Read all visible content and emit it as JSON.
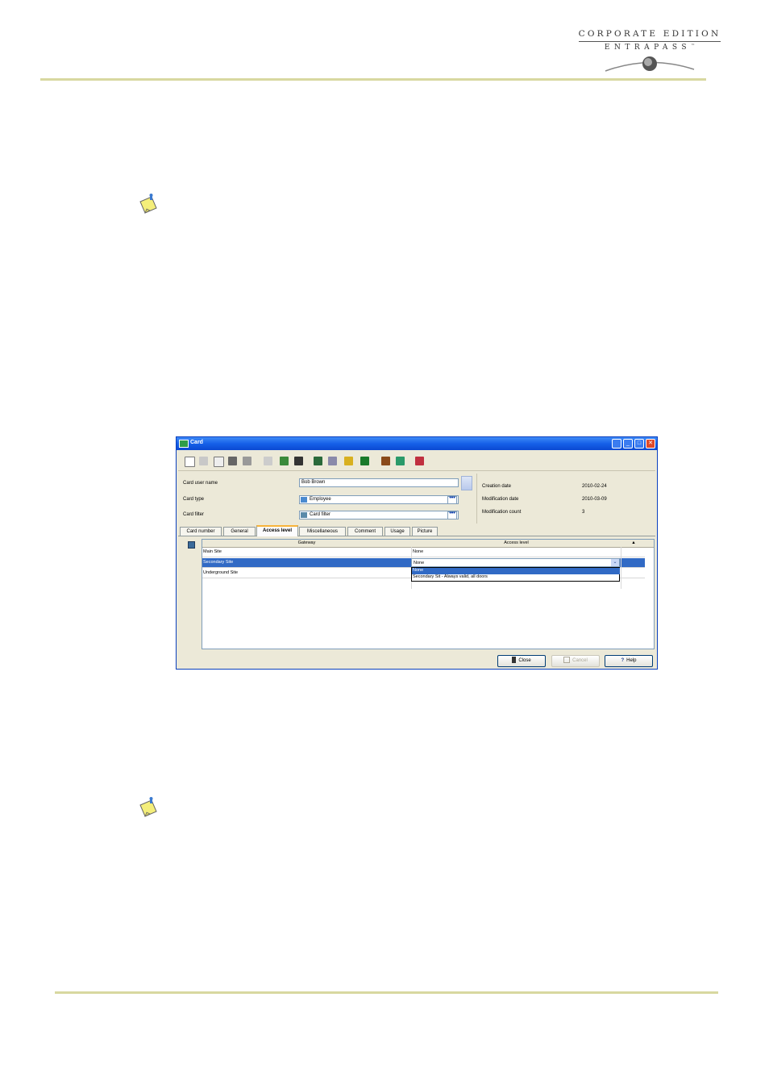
{
  "brand": {
    "line1": "CORPORATE EDITION",
    "line2": "ENTRAPASS",
    "tm": "™"
  },
  "window": {
    "title": "Card",
    "icon": "card-app-icon",
    "controls": [
      "help-icon",
      "minimize-icon",
      "maximize-icon",
      "close-icon"
    ]
  },
  "toolbar": {
    "tools": [
      "new-icon",
      "save-icon",
      "copy-icon",
      "delete-icon",
      "print-icon",
      "list-icon",
      "edit-icon",
      "binoculars-icon",
      "find-icon",
      "grid-icon",
      "key-icon",
      "calendar-icon",
      "photo-icon",
      "link-icon",
      "exit-icon"
    ]
  },
  "form": {
    "card_user_name_label": "Card user name",
    "card_user_name_value": "Bob Brown",
    "card_type_label": "Card type",
    "card_type_value": "Employee",
    "card_filter_label": "Card filter",
    "card_filter_value": "Card filter",
    "ellipsis": "•••"
  },
  "info": {
    "creation_date_label": "Creation date",
    "creation_date_value": "2010-02-24",
    "modification_date_label": "Modification date",
    "modification_date_value": "2010-03-09",
    "modification_count_label": "Modification count",
    "modification_count_value": "3"
  },
  "tabs": [
    {
      "label": "Card number"
    },
    {
      "label": "General"
    },
    {
      "label": "Access level"
    },
    {
      "label": "Miscellaneous"
    },
    {
      "label": "Comment"
    },
    {
      "label": "Usage"
    },
    {
      "label": "Picture"
    }
  ],
  "grid": {
    "col_gateway": "Gateway",
    "col_access_level": "Access level",
    "rows": [
      {
        "gateway": "Main Site",
        "access": "None"
      },
      {
        "gateway": "Secondary Site",
        "access": "None"
      },
      {
        "gateway": "Underground Site",
        "access": ""
      }
    ],
    "dropdown_options": [
      "None",
      "Secondary Sit - Always valid, all doors"
    ]
  },
  "buttons": {
    "close": "Close",
    "cancel": "Cancel",
    "help": "Help"
  }
}
